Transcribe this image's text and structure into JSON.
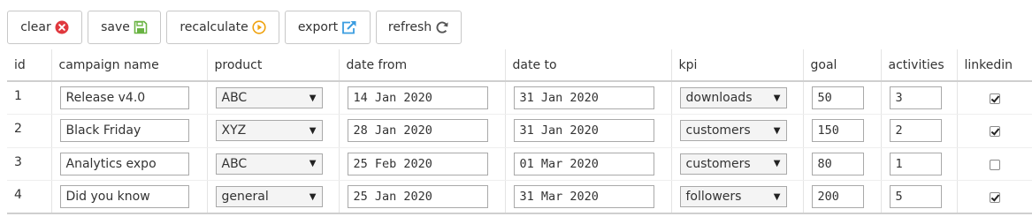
{
  "toolbar": {
    "clear": {
      "label": "clear",
      "icon": "close-circle-icon",
      "color": "#e0383e"
    },
    "save": {
      "label": "save",
      "icon": "floppy-disk-icon",
      "color": "#69b342"
    },
    "recalculate": {
      "label": "recalculate",
      "icon": "play-circle-icon",
      "color": "#efa20f"
    },
    "export": {
      "label": "export",
      "icon": "export-arrow-icon",
      "color": "#3a9ce0"
    },
    "refresh": {
      "label": "refresh",
      "icon": "refresh-icon",
      "color": "#555555"
    }
  },
  "columns": [
    "id",
    "campaign name",
    "product",
    "date from",
    "date to",
    "kpi",
    "goal",
    "activities",
    "linkedin"
  ],
  "rows": [
    {
      "id": "1",
      "campaign_name": "Release v4.0",
      "product": "ABC",
      "date_from": "14 Jan 2020",
      "date_to": "31 Jan 2020",
      "kpi": "downloads",
      "goal": "50",
      "activities": "3",
      "linkedin": true
    },
    {
      "id": "2",
      "campaign_name": "Black Friday",
      "product": "XYZ",
      "date_from": "28 Jan 2020",
      "date_to": "31 Jan 2020",
      "kpi": "customers",
      "goal": "150",
      "activities": "2",
      "linkedin": true
    },
    {
      "id": "3",
      "campaign_name": "Analytics expo",
      "product": "ABC",
      "date_from": "25 Feb 2020",
      "date_to": "01 Mar 2020",
      "kpi": "customers",
      "goal": "80",
      "activities": "1",
      "linkedin": false
    },
    {
      "id": "4",
      "campaign_name": "Did you know",
      "product": "general",
      "date_from": "25 Jan 2020",
      "date_to": "31 Mar 2020",
      "kpi": "followers",
      "goal": "200",
      "activities": "5",
      "linkedin": true
    }
  ]
}
